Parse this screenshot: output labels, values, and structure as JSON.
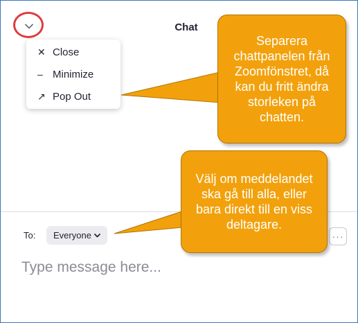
{
  "header": {
    "title": "Chat",
    "collapse_icon": "chevron-down-icon"
  },
  "menu": {
    "items": [
      {
        "label": "Close",
        "icon": "close-icon",
        "glyph": "✕"
      },
      {
        "label": "Minimize",
        "icon": "minimize-icon",
        "glyph": "–"
      },
      {
        "label": "Pop Out",
        "icon": "pop-out-arrow-icon",
        "glyph": "↗"
      }
    ]
  },
  "composer": {
    "to_label": "To:",
    "recipient": "Everyone",
    "recipient_icon": "chevron-down-icon",
    "more_icon": "ellipsis-icon",
    "more_glyph": "···",
    "placeholder": "Type message here..."
  },
  "callouts": {
    "popout_tip": "Separera chattpanelen från Zoomfönstret, då kan du fritt ändra storleken på chatten.",
    "recipient_tip": "Välj om meddelandet ska gå till alla, eller bara direkt till en viss deltagare."
  },
  "colors": {
    "callout_fill": "#f2a10c",
    "highlight_ring": "#e03a3e",
    "frame_border": "#3a77b8"
  }
}
